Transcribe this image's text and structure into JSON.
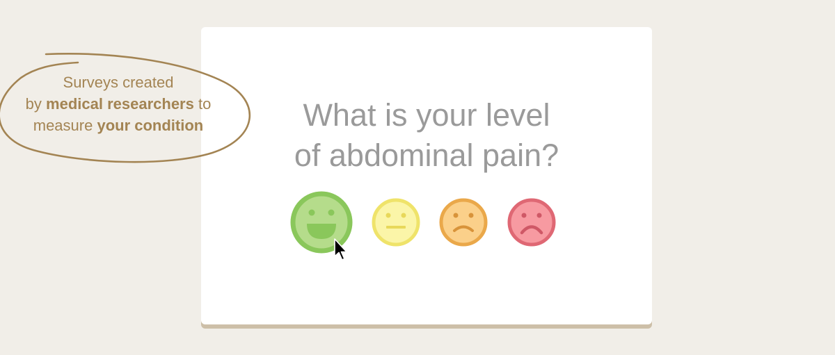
{
  "question": {
    "line1": "What is your level",
    "line2": "of abdominal pain?"
  },
  "annotation": {
    "line1": "Surveys created",
    "line2_prefix": "by ",
    "line2_bold": "medical researchers",
    "line2_suffix": " to",
    "line3_prefix": "measure ",
    "line3_bold": "your condition"
  },
  "faces": [
    {
      "name": "very-happy",
      "icon": "grinning-face-icon",
      "fill": "#b5dc8b",
      "stroke": "#8ac75b",
      "feature": "#8ac75b",
      "selected": true
    },
    {
      "name": "neutral",
      "icon": "neutral-face-icon",
      "fill": "#fbf5a8",
      "stroke": "#efe36a",
      "feature": "#e8d85a"
    },
    {
      "name": "sad",
      "icon": "slightly-sad-face-icon",
      "fill": "#fbd08a",
      "stroke": "#eaa84a",
      "feature": "#d8933a"
    },
    {
      "name": "very-sad",
      "icon": "sad-face-icon",
      "fill": "#f79aa1",
      "stroke": "#df6874",
      "feature": "#cf5866"
    }
  ],
  "colors": {
    "background": "#f1eee8",
    "card": "#ffffff",
    "card_shadow": "#cdbfa8",
    "question_text": "#9a9a9a",
    "annotation": "#a38453"
  }
}
